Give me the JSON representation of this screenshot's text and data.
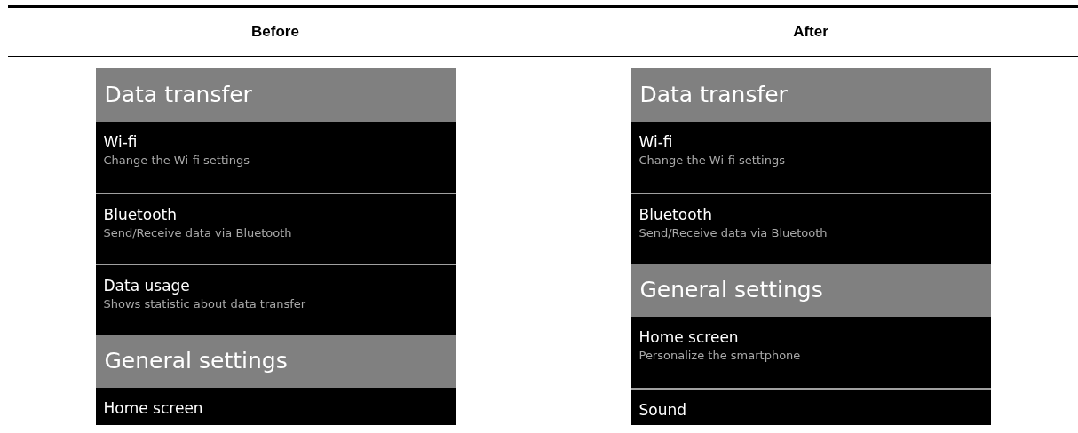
{
  "columns": [
    {
      "header": "Before",
      "screen": {
        "rows": [
          {
            "kind": "heading",
            "title": "Data transfer"
          },
          {
            "kind": "item",
            "title": "Wi-fi",
            "subtitle": "Change the Wi-fi settings"
          },
          {
            "kind": "item",
            "title": "Bluetooth",
            "subtitle": "Send/Receive data via Bluetooth"
          },
          {
            "kind": "item",
            "title": "Data usage",
            "subtitle": "Shows statistic about data transfer"
          },
          {
            "kind": "heading",
            "title": "General settings"
          },
          {
            "kind": "item",
            "title": "Home screen"
          }
        ]
      }
    },
    {
      "header": "After",
      "screen": {
        "rows": [
          {
            "kind": "heading",
            "title": "Data transfer"
          },
          {
            "kind": "item",
            "title": "Wi-fi",
            "subtitle": "Change the Wi-fi settings"
          },
          {
            "kind": "item",
            "title": "Bluetooth",
            "subtitle": "Send/Receive data via Bluetooth"
          },
          {
            "kind": "heading",
            "title": "General settings"
          },
          {
            "kind": "item",
            "title": "Home screen",
            "subtitle": "Personalize the smartphone"
          },
          {
            "kind": "item",
            "title": "Sound"
          }
        ]
      }
    }
  ]
}
